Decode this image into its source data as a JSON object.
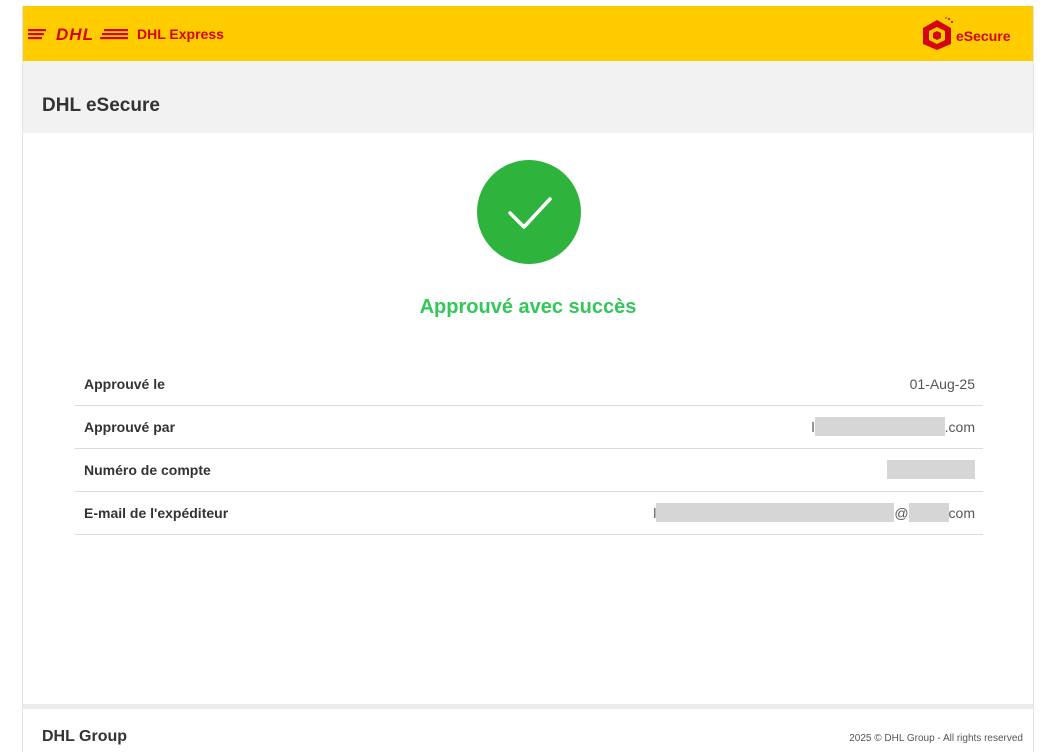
{
  "header": {
    "brand_logo_text": "DHL",
    "brand_text": "DHL Express",
    "product_logo_text": "eSecure",
    "product_logo_icon": "esecure-cube-icon"
  },
  "subheader": {
    "title": "DHL eSecure"
  },
  "status": {
    "icon": "checkmark-icon",
    "title": "Approuvé avec succès",
    "color": "#34c759"
  },
  "details": {
    "approved_on": {
      "label": "Approuvé le",
      "value": "01-Aug-25"
    },
    "approved_by": {
      "label": "Approuvé par",
      "value_prefix": "l",
      "value_suffix": ".com"
    },
    "account_number": {
      "label": "Numéro de compte"
    },
    "sender_email": {
      "label": "E-mail de l'expéditeur",
      "value_prefix": "l",
      "value_middle": "@",
      "value_suffix": "com"
    }
  },
  "footer": {
    "company": "DHL Group",
    "copyright": "2025 © DHL Group - All rights reserved"
  },
  "colors": {
    "brand_yellow": "#ffcc00",
    "brand_red": "#d40511",
    "success_green": "#2eb33c"
  }
}
